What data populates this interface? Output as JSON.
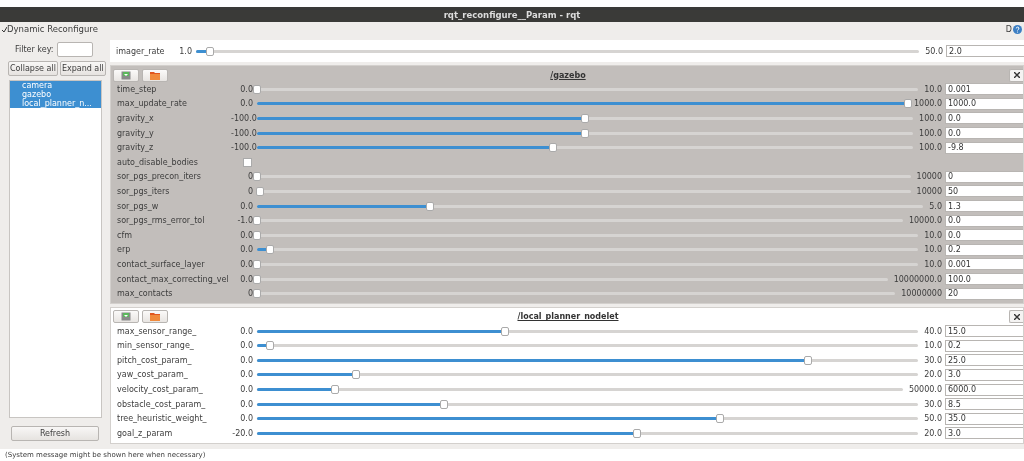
{
  "window": {
    "title": "rqt_reconfigure__Param - rqt"
  },
  "dock": {
    "title": "Dynamic Reconfigure",
    "top_right_label": "D"
  },
  "sidebar": {
    "filter_label": "Filter key:",
    "buttons": [
      "Collapse all",
      "Expand all"
    ],
    "items": [
      {
        "label": "camera",
        "selected": true
      },
      {
        "label": "gazebo",
        "selected": true
      },
      {
        "label": "local_planner_n...",
        "selected": true
      }
    ],
    "refresh": "Refresh"
  },
  "top_param": {
    "name": "imager_rate",
    "min": "1.0",
    "max": "50.0",
    "value": "2.0",
    "level": 0.02
  },
  "groups": [
    {
      "title": "/gazebo",
      "highlighted": true,
      "params": [
        {
          "kind": "slider",
          "name": "time_step",
          "min": "0.0",
          "max": "10.0",
          "value": "0.001",
          "level": 0.0
        },
        {
          "kind": "slider",
          "name": "max_update_rate",
          "min": "0.0",
          "max": "1000.0",
          "value": "1000.0",
          "level": 1.0
        },
        {
          "kind": "slider",
          "name": "gravity_x",
          "min": "-100.0",
          "max": "100.0",
          "value": "0.0",
          "level": 0.5
        },
        {
          "kind": "slider",
          "name": "gravity_y",
          "min": "-100.0",
          "max": "100.0",
          "value": "0.0",
          "level": 0.5
        },
        {
          "kind": "slider",
          "name": "gravity_z",
          "min": "-100.0",
          "max": "100.0",
          "value": "-9.8",
          "level": 0.451
        },
        {
          "kind": "bool",
          "name": "auto_disable_bodies",
          "checked": false
        },
        {
          "kind": "slider",
          "name": "sor_pgs_precon_iters",
          "min": "0",
          "max": "10000",
          "value": "0",
          "level": 0.0
        },
        {
          "kind": "slider",
          "name": "sor_pgs_iters",
          "min": "0",
          "max": "10000",
          "value": "50",
          "level": 0.005
        },
        {
          "kind": "slider",
          "name": "sor_pgs_w",
          "min": "0.0",
          "max": "5.0",
          "value": "1.3",
          "level": 0.26
        },
        {
          "kind": "slider",
          "name": "sor_pgs_rms_error_tol",
          "min": "-1.0",
          "max": "10000.0",
          "value": "0.0",
          "level": 0.0
        },
        {
          "kind": "slider",
          "name": "cfm",
          "min": "0.0",
          "max": "10.0",
          "value": "0.0",
          "level": 0.0
        },
        {
          "kind": "slider",
          "name": "erp",
          "min": "0.0",
          "max": "10.0",
          "value": "0.2",
          "level": 0.02
        },
        {
          "kind": "slider",
          "name": "contact_surface_layer",
          "min": "0.0",
          "max": "10.0",
          "value": "0.001",
          "level": 0.0
        },
        {
          "kind": "slider",
          "name": "contact_max_correcting_vel",
          "min": "0.0",
          "max": "10000000.0",
          "value": "100.0",
          "level": 0.0
        },
        {
          "kind": "slider",
          "name": "max_contacts",
          "min": "0",
          "max": "10000000",
          "value": "20",
          "level": 0.0
        }
      ]
    },
    {
      "title": "/local_planner_nodelet",
      "highlighted": false,
      "params": [
        {
          "kind": "slider",
          "name": "max_sensor_range_",
          "min": "0.0",
          "max": "40.0",
          "value": "15.0",
          "level": 0.375
        },
        {
          "kind": "slider",
          "name": "min_sensor_range_",
          "min": "0.0",
          "max": "10.0",
          "value": "0.2",
          "level": 0.02
        },
        {
          "kind": "slider",
          "name": "pitch_cost_param_",
          "min": "0.0",
          "max": "30.0",
          "value": "25.0",
          "level": 0.833
        },
        {
          "kind": "slider",
          "name": "yaw_cost_param_",
          "min": "0.0",
          "max": "20.0",
          "value": "3.0",
          "level": 0.15
        },
        {
          "kind": "slider",
          "name": "velocity_cost_param_",
          "min": "0.0",
          "max": "50000.0",
          "value": "6000.0",
          "level": 0.12
        },
        {
          "kind": "slider",
          "name": "obstacle_cost_param_",
          "min": "0.0",
          "max": "30.0",
          "value": "8.5",
          "level": 0.283
        },
        {
          "kind": "slider",
          "name": "tree_heuristic_weight_",
          "min": "0.0",
          "max": "50.0",
          "value": "35.0",
          "level": 0.7
        },
        {
          "kind": "slider",
          "name": "goal_z_param",
          "min": "-20.0",
          "max": "20.0",
          "value": "3.0",
          "level": 0.575
        }
      ]
    }
  ],
  "status_bar": "(System message might be shown here when necessary)"
}
